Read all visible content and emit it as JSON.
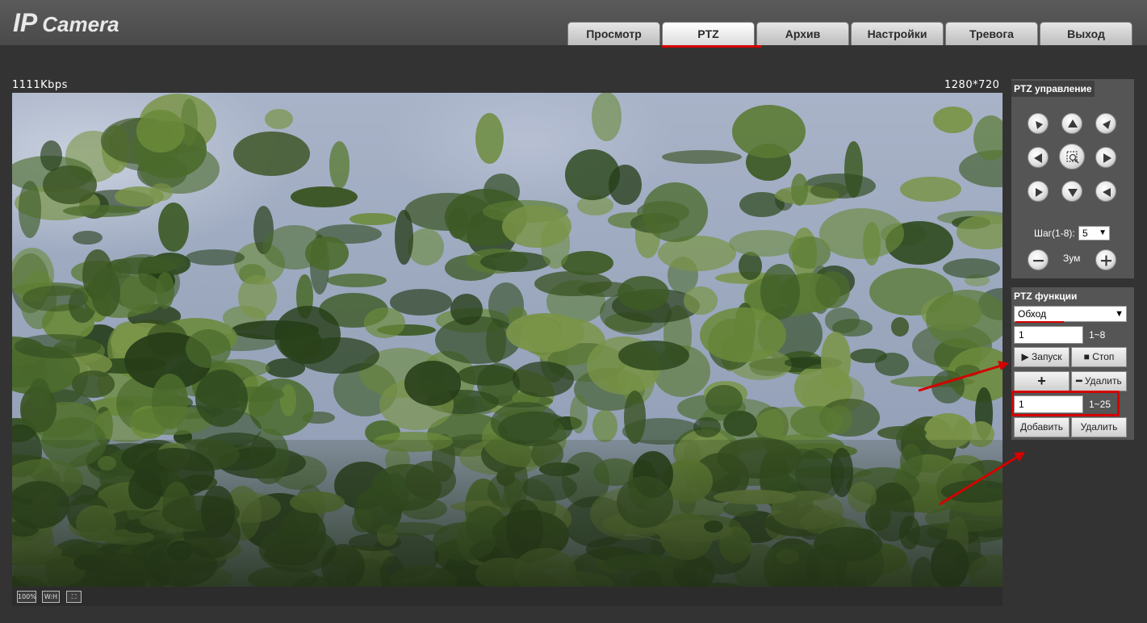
{
  "header": {
    "logo_ip": "IP",
    "logo_camera": "Camera",
    "tabs": [
      {
        "label": "Просмотр",
        "active": false
      },
      {
        "label": "PTZ",
        "active": true
      },
      {
        "label": "Архив",
        "active": false
      },
      {
        "label": "Настройки",
        "active": false
      },
      {
        "label": "Тревога",
        "active": false
      },
      {
        "label": "Выход",
        "active": false
      }
    ]
  },
  "video": {
    "bitrate": "1111Kbps",
    "resolution": "1280*720",
    "toolbar": {
      "zoom_label": "100%",
      "wh_label": "W:H",
      "full_label": "⛶"
    }
  },
  "ptz_control": {
    "title": "PTZ управление",
    "directions": [
      "up-left",
      "up",
      "up-right",
      "left",
      "auto",
      "right",
      "down-left",
      "down",
      "down-right"
    ],
    "step_label": "Шаг(1-8):",
    "step_value": "5",
    "zoom_label": "Зум"
  },
  "ptz_functions": {
    "title": "PTZ функции",
    "mode_value": "Обход",
    "line_value": "1",
    "line_range": "1~8",
    "start_label": "Запуск",
    "stop_label": "Стоп",
    "add_plus_label": "+",
    "delete_minus_label": "Удалить",
    "preset_value": "1",
    "preset_range": "1~25",
    "add_label": "Добавить",
    "delete_label": "Удалить"
  },
  "annotation_color": "#d40000"
}
